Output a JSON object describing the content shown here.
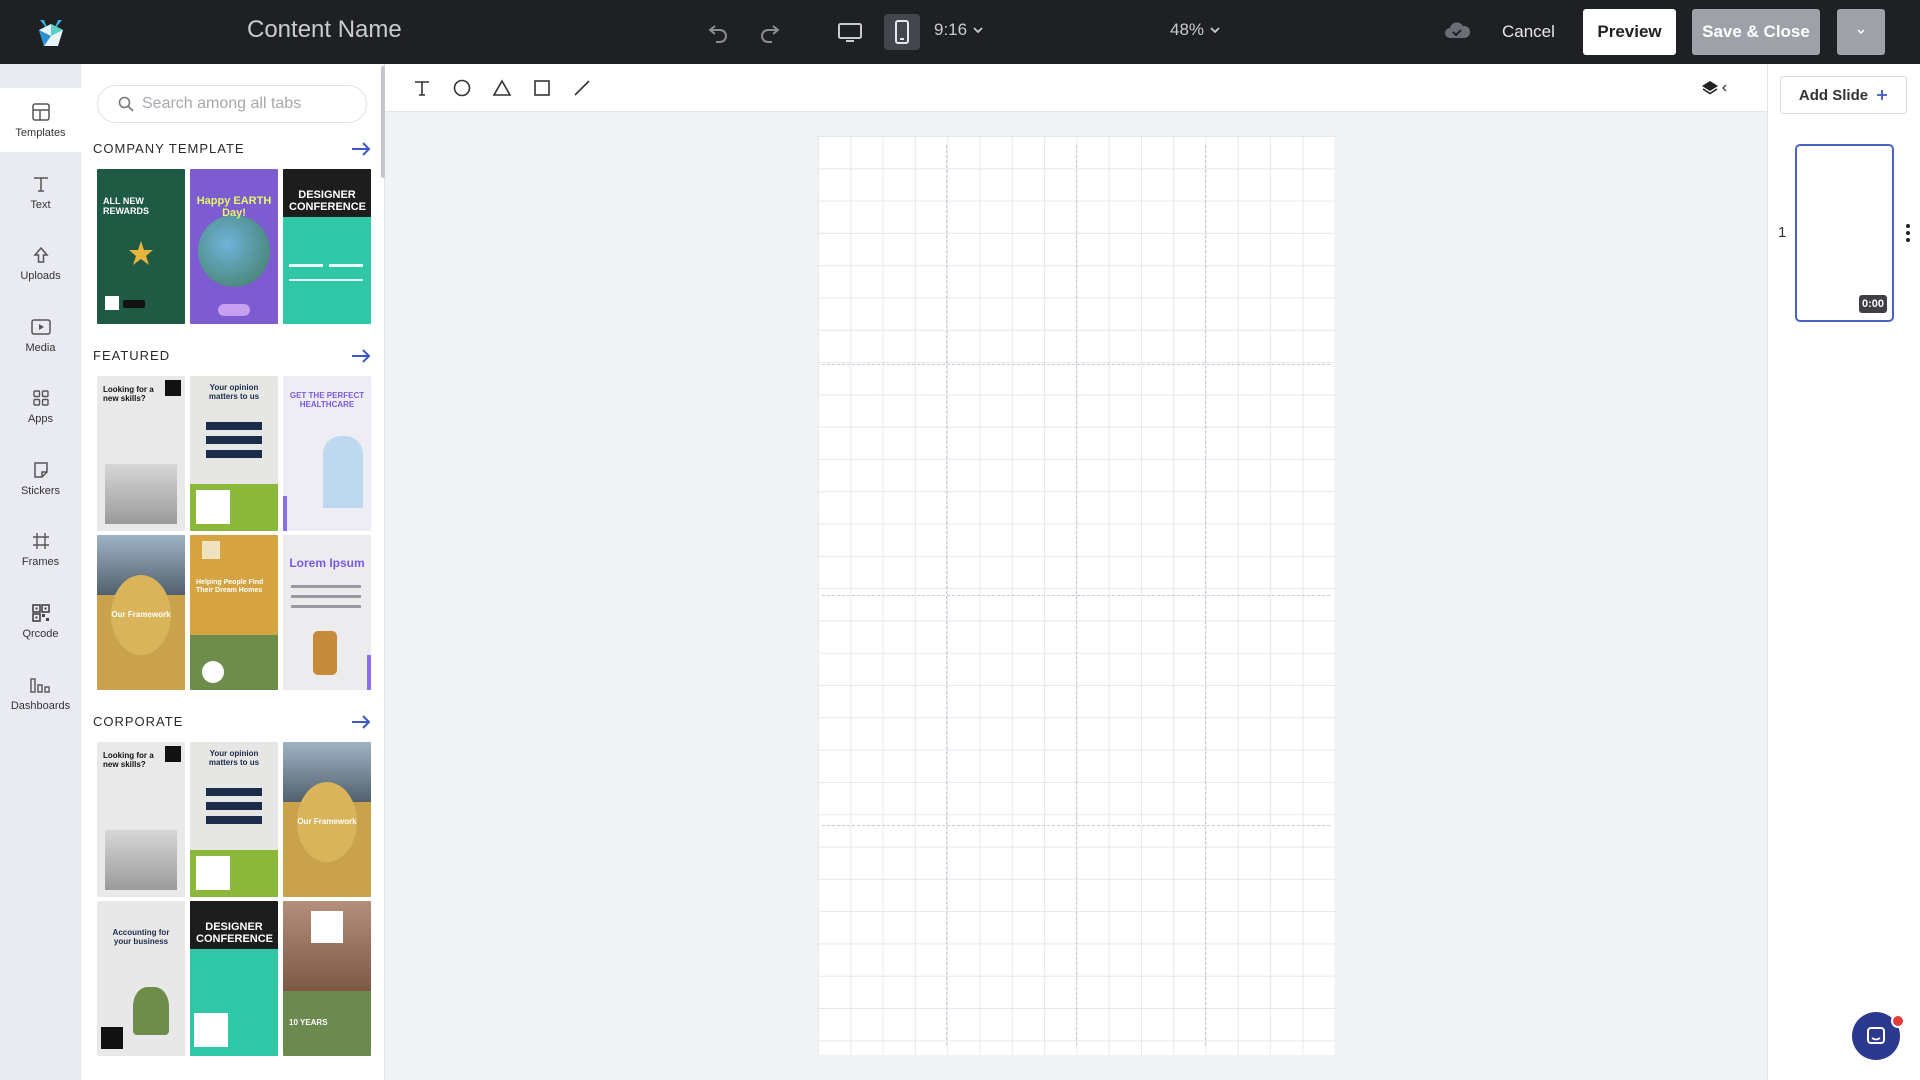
{
  "header": {
    "content_name": "Content Name",
    "aspect_ratio": "9:16",
    "zoom": "48%",
    "cancel_label": "Cancel",
    "preview_label": "Preview",
    "save_label": "Save & Close"
  },
  "rail": {
    "items": [
      {
        "label": "Templates",
        "icon": "templates-icon"
      },
      {
        "label": "Text",
        "icon": "text-icon"
      },
      {
        "label": "Uploads",
        "icon": "upload-icon"
      },
      {
        "label": "Media",
        "icon": "media-icon"
      },
      {
        "label": "Apps",
        "icon": "apps-icon"
      },
      {
        "label": "Stickers",
        "icon": "sticker-icon"
      },
      {
        "label": "Frames",
        "icon": "frame-icon"
      },
      {
        "label": "Qrcode",
        "icon": "qrcode-icon"
      },
      {
        "label": "Dashboards",
        "icon": "dashboard-icon"
      }
    ]
  },
  "search": {
    "placeholder": "Search among all tabs"
  },
  "sections": [
    {
      "title": "COMPANY TEMPLATE",
      "thumbs": [
        {
          "text": "ALL NEW REWARDS",
          "bg": "#1f5a45"
        },
        {
          "text": "Happy EARTH Day!",
          "bg": "#7d5bd0"
        },
        {
          "text": "DESIGNER CONFERENCE",
          "bg": "#2fc7a6"
        }
      ]
    },
    {
      "title": "FEATURED",
      "thumbs": [
        {
          "text": "Looking for a new skills?",
          "bg": "#e9e9e9"
        },
        {
          "text": "Your opinion matters to us",
          "bg": "#e6e6e4"
        },
        {
          "text": "GET THE PERFECT HEALTHCARE",
          "bg": "#ededf3"
        },
        {
          "text": "Our Framework",
          "bg": "#c9a24b"
        },
        {
          "text": "Helping People Find Their Dream Homes",
          "bg": "#d5a441"
        },
        {
          "text": "Lorem Ipsum",
          "bg": "#ececee"
        }
      ]
    },
    {
      "title": "CORPORATE",
      "thumbs": [
        {
          "text": "Looking for a new skills?",
          "bg": "#e9e9e9"
        },
        {
          "text": "Your opinion matters to us",
          "bg": "#e6e6e4"
        },
        {
          "text": "Our Framework",
          "bg": "#c9a24b"
        },
        {
          "text": "Accounting for your business",
          "bg": "#e8e8e8"
        },
        {
          "text": "DESIGNER CONFERENCE",
          "bg": "#2fc7a6"
        },
        {
          "text": "10 YEARS",
          "bg": "#6c8a4f"
        }
      ]
    }
  ],
  "slides": {
    "add_label": "Add Slide",
    "items": [
      {
        "number": "1",
        "duration": "0:00"
      }
    ]
  },
  "colors": {
    "topbar": "#1f2024",
    "accent": "#4a63c9",
    "save_disabled": "#9ea2a8",
    "rail_bg": "#e9eaf2"
  }
}
